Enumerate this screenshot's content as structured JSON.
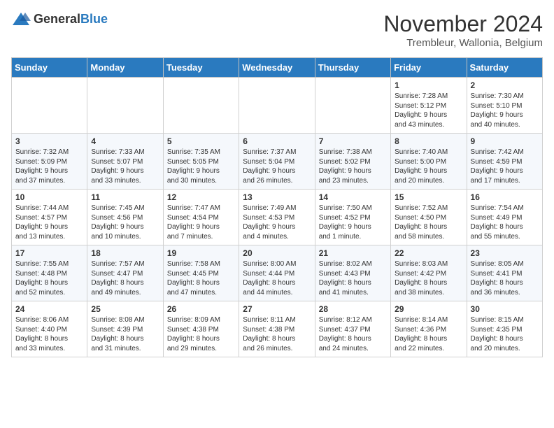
{
  "logo": {
    "general": "General",
    "blue": "Blue"
  },
  "header": {
    "month": "November 2024",
    "location": "Trembleur, Wallonia, Belgium"
  },
  "weekdays": [
    "Sunday",
    "Monday",
    "Tuesday",
    "Wednesday",
    "Thursday",
    "Friday",
    "Saturday"
  ],
  "weeks": [
    [
      {
        "day": "",
        "info": ""
      },
      {
        "day": "",
        "info": ""
      },
      {
        "day": "",
        "info": ""
      },
      {
        "day": "",
        "info": ""
      },
      {
        "day": "",
        "info": ""
      },
      {
        "day": "1",
        "info": "Sunrise: 7:28 AM\nSunset: 5:12 PM\nDaylight: 9 hours\nand 43 minutes."
      },
      {
        "day": "2",
        "info": "Sunrise: 7:30 AM\nSunset: 5:10 PM\nDaylight: 9 hours\nand 40 minutes."
      }
    ],
    [
      {
        "day": "3",
        "info": "Sunrise: 7:32 AM\nSunset: 5:09 PM\nDaylight: 9 hours\nand 37 minutes."
      },
      {
        "day": "4",
        "info": "Sunrise: 7:33 AM\nSunset: 5:07 PM\nDaylight: 9 hours\nand 33 minutes."
      },
      {
        "day": "5",
        "info": "Sunrise: 7:35 AM\nSunset: 5:05 PM\nDaylight: 9 hours\nand 30 minutes."
      },
      {
        "day": "6",
        "info": "Sunrise: 7:37 AM\nSunset: 5:04 PM\nDaylight: 9 hours\nand 26 minutes."
      },
      {
        "day": "7",
        "info": "Sunrise: 7:38 AM\nSunset: 5:02 PM\nDaylight: 9 hours\nand 23 minutes."
      },
      {
        "day": "8",
        "info": "Sunrise: 7:40 AM\nSunset: 5:00 PM\nDaylight: 9 hours\nand 20 minutes."
      },
      {
        "day": "9",
        "info": "Sunrise: 7:42 AM\nSunset: 4:59 PM\nDaylight: 9 hours\nand 17 minutes."
      }
    ],
    [
      {
        "day": "10",
        "info": "Sunrise: 7:44 AM\nSunset: 4:57 PM\nDaylight: 9 hours\nand 13 minutes."
      },
      {
        "day": "11",
        "info": "Sunrise: 7:45 AM\nSunset: 4:56 PM\nDaylight: 9 hours\nand 10 minutes."
      },
      {
        "day": "12",
        "info": "Sunrise: 7:47 AM\nSunset: 4:54 PM\nDaylight: 9 hours\nand 7 minutes."
      },
      {
        "day": "13",
        "info": "Sunrise: 7:49 AM\nSunset: 4:53 PM\nDaylight: 9 hours\nand 4 minutes."
      },
      {
        "day": "14",
        "info": "Sunrise: 7:50 AM\nSunset: 4:52 PM\nDaylight: 9 hours\nand 1 minute."
      },
      {
        "day": "15",
        "info": "Sunrise: 7:52 AM\nSunset: 4:50 PM\nDaylight: 8 hours\nand 58 minutes."
      },
      {
        "day": "16",
        "info": "Sunrise: 7:54 AM\nSunset: 4:49 PM\nDaylight: 8 hours\nand 55 minutes."
      }
    ],
    [
      {
        "day": "17",
        "info": "Sunrise: 7:55 AM\nSunset: 4:48 PM\nDaylight: 8 hours\nand 52 minutes."
      },
      {
        "day": "18",
        "info": "Sunrise: 7:57 AM\nSunset: 4:47 PM\nDaylight: 8 hours\nand 49 minutes."
      },
      {
        "day": "19",
        "info": "Sunrise: 7:58 AM\nSunset: 4:45 PM\nDaylight: 8 hours\nand 47 minutes."
      },
      {
        "day": "20",
        "info": "Sunrise: 8:00 AM\nSunset: 4:44 PM\nDaylight: 8 hours\nand 44 minutes."
      },
      {
        "day": "21",
        "info": "Sunrise: 8:02 AM\nSunset: 4:43 PM\nDaylight: 8 hours\nand 41 minutes."
      },
      {
        "day": "22",
        "info": "Sunrise: 8:03 AM\nSunset: 4:42 PM\nDaylight: 8 hours\nand 38 minutes."
      },
      {
        "day": "23",
        "info": "Sunrise: 8:05 AM\nSunset: 4:41 PM\nDaylight: 8 hours\nand 36 minutes."
      }
    ],
    [
      {
        "day": "24",
        "info": "Sunrise: 8:06 AM\nSunset: 4:40 PM\nDaylight: 8 hours\nand 33 minutes."
      },
      {
        "day": "25",
        "info": "Sunrise: 8:08 AM\nSunset: 4:39 PM\nDaylight: 8 hours\nand 31 minutes."
      },
      {
        "day": "26",
        "info": "Sunrise: 8:09 AM\nSunset: 4:38 PM\nDaylight: 8 hours\nand 29 minutes."
      },
      {
        "day": "27",
        "info": "Sunrise: 8:11 AM\nSunset: 4:38 PM\nDaylight: 8 hours\nand 26 minutes."
      },
      {
        "day": "28",
        "info": "Sunrise: 8:12 AM\nSunset: 4:37 PM\nDaylight: 8 hours\nand 24 minutes."
      },
      {
        "day": "29",
        "info": "Sunrise: 8:14 AM\nSunset: 4:36 PM\nDaylight: 8 hours\nand 22 minutes."
      },
      {
        "day": "30",
        "info": "Sunrise: 8:15 AM\nSunset: 4:35 PM\nDaylight: 8 hours\nand 20 minutes."
      }
    ]
  ]
}
